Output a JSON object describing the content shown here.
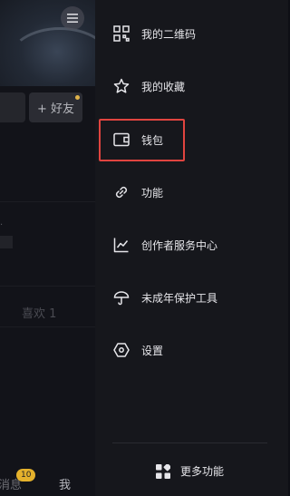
{
  "left_panel": {
    "add_friend": "+ 好友",
    "likes": "喜欢 1",
    "tabs": {
      "messages": "消息",
      "messages_badge": "10",
      "me": "我"
    }
  },
  "drawer": {
    "items": [
      {
        "label": "我的二维码",
        "icon": "qr-code-icon"
      },
      {
        "label": "我的收藏",
        "icon": "star-icon"
      },
      {
        "label": "钱包",
        "icon": "wallet-icon"
      },
      {
        "label": "功能",
        "icon": "link-icon"
      },
      {
        "label": "创作者服务中心",
        "icon": "chart-line-icon"
      },
      {
        "label": "未成年保护工具",
        "icon": "umbrella-icon"
      },
      {
        "label": "设置",
        "icon": "settings-icon"
      }
    ],
    "more": "更多功能"
  },
  "colors": {
    "highlight": "#e0443f",
    "badge": "#e4b12c"
  }
}
